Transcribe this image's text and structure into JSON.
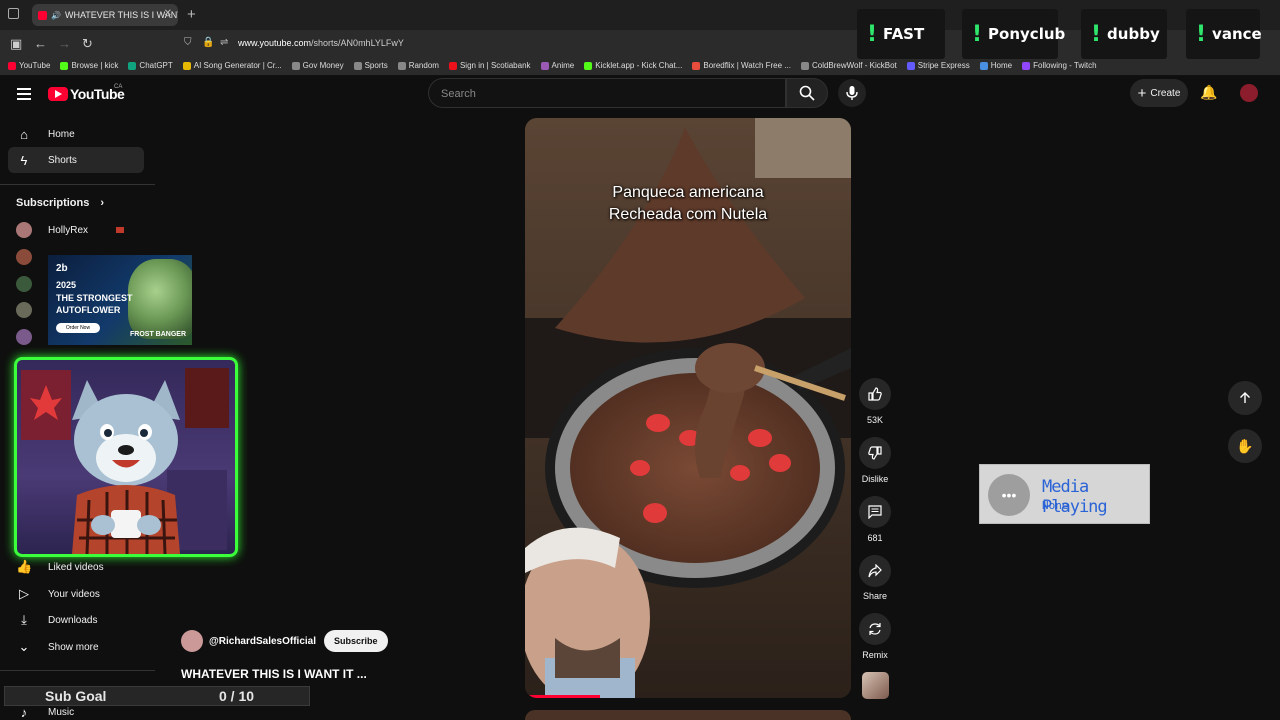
{
  "browser": {
    "tab_title": "WHATEVER THIS IS I WANT",
    "url_host": "www.youtube.com",
    "url_path": "/shorts/AN0mhLYLFwY",
    "bookmarks": [
      "YouTube",
      "Browse | kick",
      "ChatGPT",
      "AI Song Generator | Cr...",
      "Gov Money",
      "Sports",
      "Random",
      "Sign in | Scotiabank",
      "Anime",
      "Kicklet.app - Kick Chat...",
      "Boredflix | Watch Free ...",
      "ColdBrewWolf - KickBot",
      "Stripe Express",
      "Home",
      "Following - Twitch"
    ]
  },
  "overlay_commands": [
    "FAST",
    "Ponyclub",
    "dubby",
    "vance"
  ],
  "header": {
    "logo_text": "YouTube",
    "country": "CA",
    "search_placeholder": "Search",
    "create_label": "Create"
  },
  "sidebar": {
    "home": "Home",
    "shorts": "Shorts",
    "subscriptions": "Subscriptions",
    "sub_first": "HollyRex",
    "liked": "Liked videos",
    "your_videos": "Your videos",
    "downloads": "Downloads",
    "show_more": "Show more",
    "music": "Music"
  },
  "ad": {
    "brand": "2b",
    "line1": "2025",
    "line2": "THE STRONGEST",
    "line3": "AUTOFLOWER",
    "cta": "Order Now",
    "product": "FROST BANGER"
  },
  "short": {
    "caption_line1": "Panqueca americana",
    "caption_line2": "Recheada com Nutela",
    "likes": "53K",
    "dislike_label": "Dislike",
    "comments": "681",
    "share_label": "Share",
    "remix_label": "Remix",
    "progress": 0.23,
    "channel": "@RichardSalesOfficial",
    "subscribe_label": "Subscribe",
    "title": "WHATEVER THIS IS I WANT IT ..."
  },
  "media_widget": {
    "title": "Media Playing",
    "subtitle": "None"
  },
  "sub_goal": {
    "label": "Sub Goal",
    "value": "0 / 10"
  },
  "colors": {
    "accent": "#ff0033",
    "overlay_green": "#3cff3c",
    "media_blue": "#2a63d6"
  }
}
